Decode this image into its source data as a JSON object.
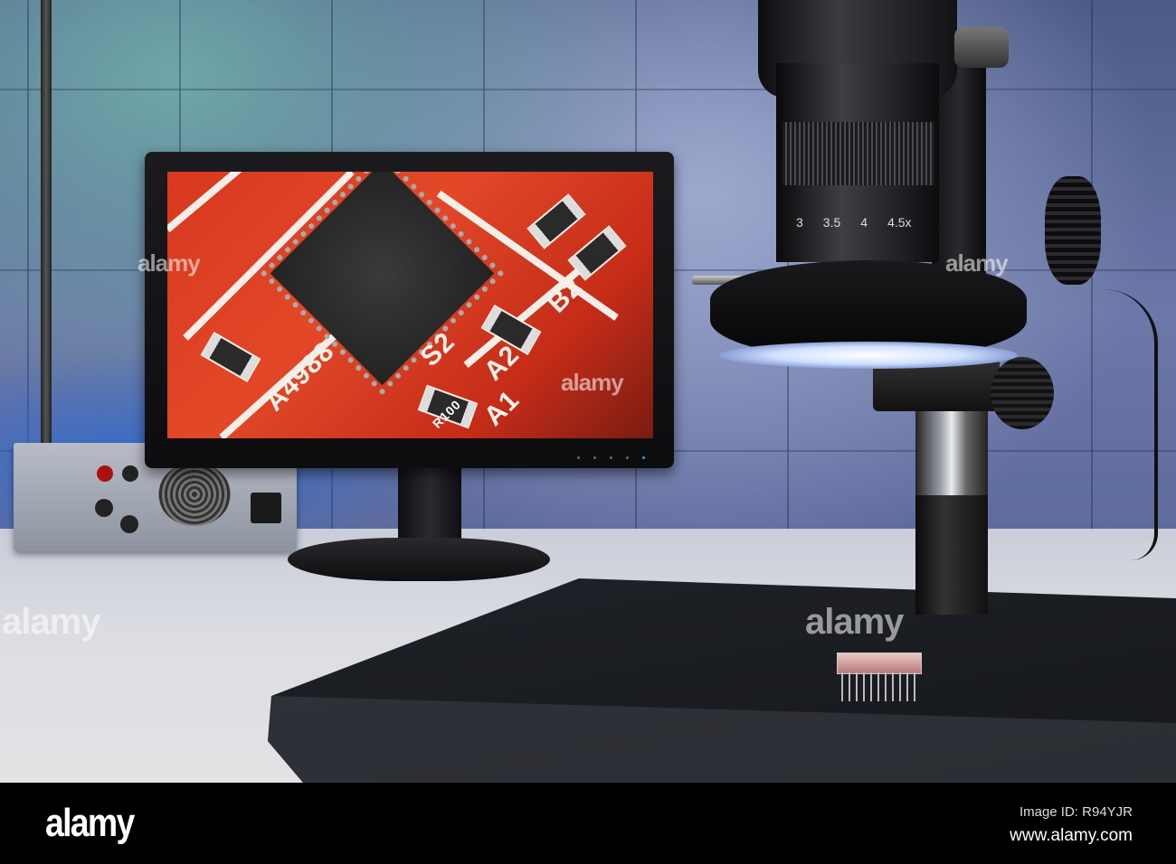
{
  "scene": {
    "lens_scale": [
      "3",
      "3.5",
      "4",
      "4.5x"
    ],
    "pcb_labels": [
      "A4988",
      "S2",
      "A2",
      "B2",
      "A1",
      "R100"
    ],
    "watermark": "alamy"
  },
  "footer": {
    "logo": "alamy",
    "image_id": "Image ID: R94YJR",
    "website": "www.alamy.com"
  }
}
